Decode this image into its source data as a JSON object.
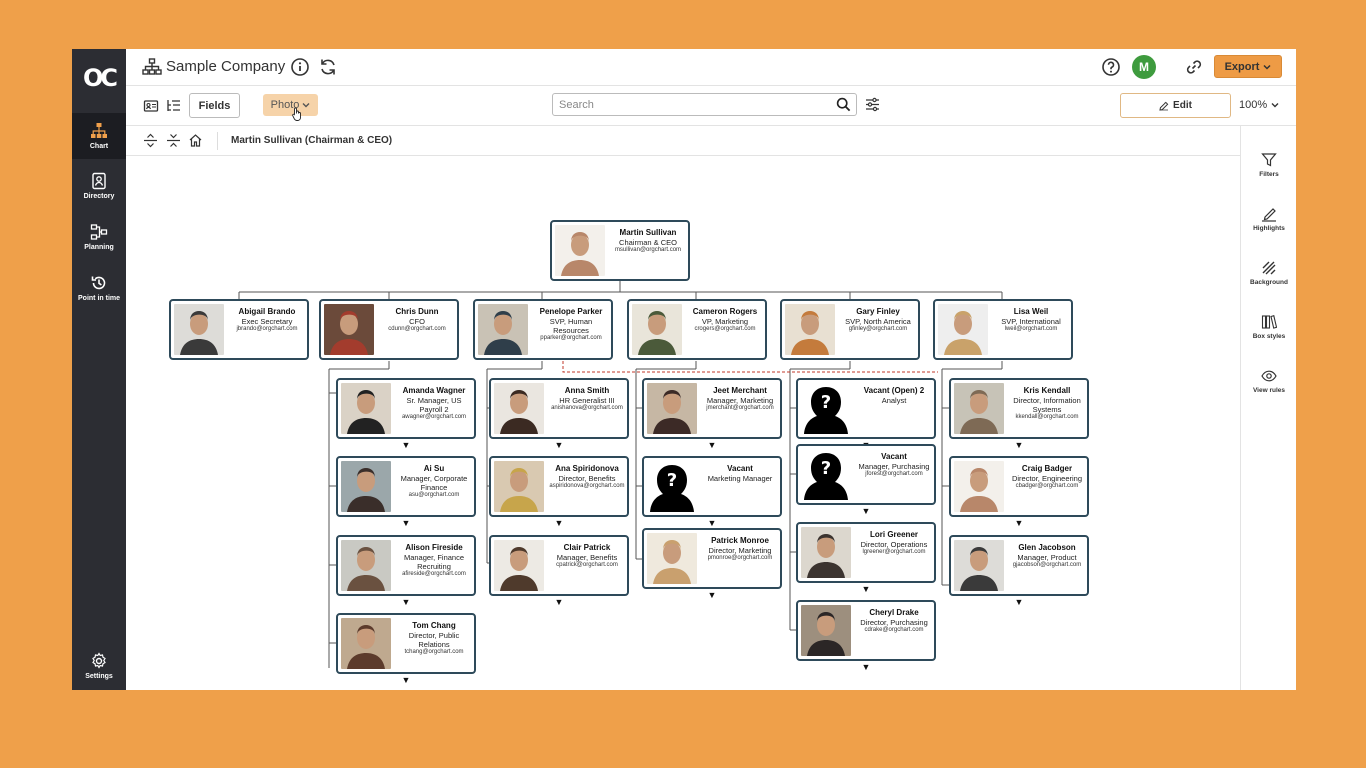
{
  "app": {
    "logo_text": "OC",
    "company_title": "Sample Company",
    "avatar_initial": "M",
    "export_label": "Export"
  },
  "nav": {
    "chart": "Chart",
    "directory": "Directory",
    "planning": "Planning",
    "point_in_time": "Point in time",
    "settings": "Settings"
  },
  "toolbar": {
    "fields_label": "Fields",
    "photo_label": "Photo",
    "search_placeholder": "Search",
    "edit_label": "Edit",
    "zoom": "100%"
  },
  "breadcrumb": "Martin Sullivan (Chairman & CEO)",
  "right_panel": {
    "filters": "Filters",
    "highlights": "Highlights",
    "background": "Background",
    "box_styles": "Box styles",
    "view_rules": "View rules"
  },
  "colors": {
    "frame_bg": "#EFA04A",
    "nav_bg": "#2C2D33",
    "accent": "#EE9B45",
    "card_border": "#2E4A5A",
    "avatar_bg": "#3E9B3E"
  },
  "org": {
    "root": {
      "name": "Martin Sullivan",
      "title": "Chairman & CEO",
      "email": "msullivan@orgchart.com"
    },
    "level1": [
      {
        "name": "Abigail Brando",
        "title": "Exec Secretary",
        "email": "jbrando@orgchart.com"
      },
      {
        "name": "Chris  Dunn",
        "title": "CFO",
        "email": "cdunn@orgchart.com"
      },
      {
        "name": "Penelope Parker",
        "title": "SVP, Human Resources",
        "email": "pparker@orgchart.com"
      },
      {
        "name": "Cameron Rogers",
        "title": "VP, Marketing",
        "email": "crogers@orgchart.com"
      },
      {
        "name": "Gary Finley",
        "title": "SVP, North America",
        "email": "gfinley@orgchart.com"
      },
      {
        "name": "Lisa Weil",
        "title": "SVP, International",
        "email": "lweil@orgchart.com"
      }
    ],
    "col_cfo": [
      {
        "name": "Amanda Wagner",
        "title": "Sr. Manager, US Payroll 2",
        "email": "awagner@orgchart.com"
      },
      {
        "name": "Ai Su",
        "title": "Manager, Corporate Finance",
        "email": "asu@orgchart.com"
      },
      {
        "name": "Alison Fireside",
        "title": "Manager, Finance Recruiting",
        "email": "afireside@orgchart.com"
      },
      {
        "name": "Tom Chang",
        "title": "Director, Public Relations",
        "email": "tchang@orgchart.com"
      }
    ],
    "col_hr": [
      {
        "name": "Anna Smith",
        "title": "HR Generalist III",
        "email": "anishanova@orgchart.com"
      },
      {
        "name": "Ana Spiridonova",
        "title": "Director, Benefits",
        "email": "aspiridonova@orgchart.com"
      },
      {
        "name": "Clair Patrick",
        "title": "Manager, Benefits",
        "email": "cpatrick@orgchart.com"
      }
    ],
    "col_mkt": [
      {
        "name": "Jeet Merchant",
        "title": "Manager, Marketing",
        "email": "jmerchant@orgchart.com"
      },
      {
        "name": "Vacant",
        "title": "Marketing Manager",
        "email": ""
      },
      {
        "name": "Patrick Monroe",
        "title": "Director, Marketing",
        "email": "pmonroe@orgchart.com"
      }
    ],
    "col_na": [
      {
        "name": "Vacant (Open) 2",
        "title": "Analyst",
        "email": ""
      },
      {
        "name": "Vacant",
        "title": "Manager, Purchasing",
        "email": "jforest@orgchart.com"
      },
      {
        "name": "Lori Greener",
        "title": "Director, Operations",
        "email": "lgreener@orgchart.com"
      },
      {
        "name": "Cheryl Drake",
        "title": "Director, Purchasing",
        "email": "cdrake@orgchart.com"
      }
    ],
    "col_intl": [
      {
        "name": "Kris Kendall",
        "title": "Director, Information Systems",
        "email": "kkendall@orgchart.com"
      },
      {
        "name": "Craig Badger",
        "title": "Director, Engineering",
        "email": "cbadger@orgchart.com"
      },
      {
        "name": "Glen Jacobson",
        "title": "Manager, Product",
        "email": "gjacobson@orgchart.com"
      }
    ]
  }
}
